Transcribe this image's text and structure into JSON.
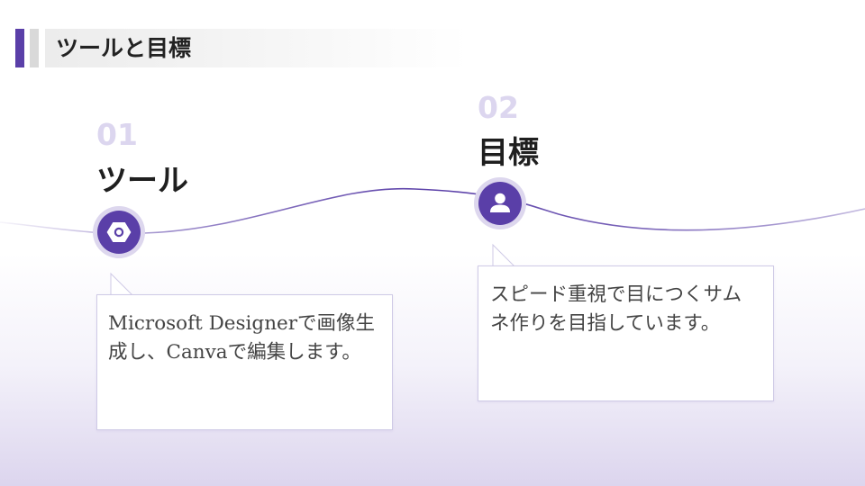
{
  "header": {
    "title": "ツールと目標"
  },
  "steps": [
    {
      "number": "01",
      "heading": "ツール",
      "icon": "hexagon-nut-icon",
      "description": "Microsoft Designerで画像生成し、Canvaで編集します。"
    },
    {
      "number": "02",
      "heading": "目標",
      "icon": "person-icon",
      "description": "スピード重視で目につくサムネ作りを目指しています。"
    }
  ],
  "colors": {
    "accent": "#5a3fa8",
    "accent_light": "#ddd7ee",
    "number_tint": "#dcd6ef",
    "bubble_border": "#cfcae6"
  }
}
